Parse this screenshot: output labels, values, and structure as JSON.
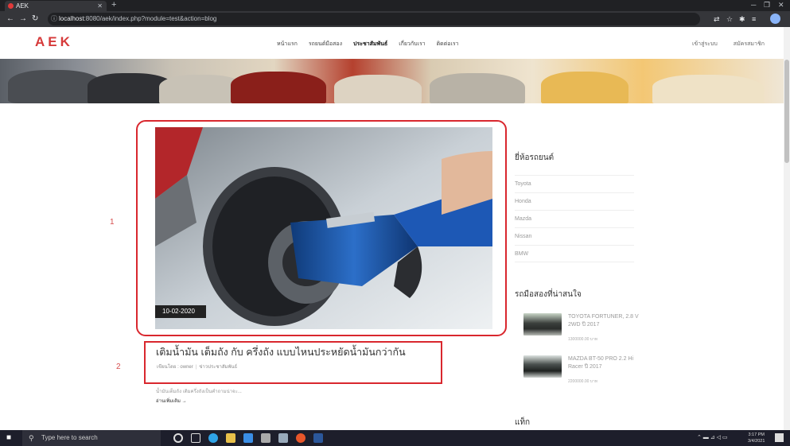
{
  "browser": {
    "tab_title": "AEK",
    "url_host": "localhost",
    "url_path": ":8080/aek/index.php?module=test&action=blog"
  },
  "site": {
    "logo": "AEK",
    "nav": [
      "หน้าแรก",
      "รถยนต์มือสอง",
      "ประชาสัมพันธ์",
      "เกี่ยวกับเรา",
      "ติดต่อเรา"
    ],
    "nav_active_index": 2,
    "auth": {
      "login": "เข้าสู่ระบบ",
      "register": "สมัครสมาชิก"
    }
  },
  "annotations": {
    "label_1": "1",
    "label_2": "2"
  },
  "post": {
    "date": "10-02-2020",
    "title": "เติมน้ำมัน เต็มถัง กับ ครึ่งถัง แบบไหนประหยัดน้ำมันกว่ากัน",
    "author": "เขียนโดย : owner",
    "category": "ข่าวประชาสัมพันธ์",
    "excerpt": "น้ำมันเต็มถัง เติมครึ่งถังเป็นคำถามน่าจะ...",
    "read_more": "อ่านเพิ่มเติม"
  },
  "sidebar": {
    "brands_heading": "ยี่ห้อรถยนต์",
    "brands": [
      "Toyota",
      "Honda",
      "Mazda",
      "Nissan",
      "BMW"
    ],
    "interesting_heading": "รถมือสองที่น่าสนใจ",
    "cars": [
      {
        "name": "TOYOTA FORTUNER, 2.8 V 2WD ปี 2017",
        "price": "1300000.00 บาท"
      },
      {
        "name": "MAZDA BT-50 PRO 2.2 Hi Racer ปี 2017",
        "price": "2200000.00 บาท"
      }
    ],
    "tags_heading": "แท็ก"
  },
  "taskbar": {
    "search_placeholder": "Type here to search",
    "time": "3:17 PM",
    "date": "3/4/2021"
  },
  "colors": {
    "brand": "#d63a3a",
    "annotation": "#d9272e"
  }
}
